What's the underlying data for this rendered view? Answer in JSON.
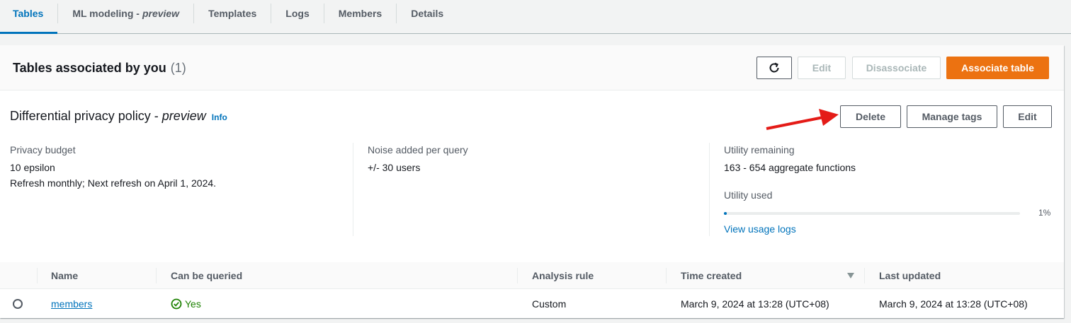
{
  "tabs": [
    {
      "label": "Tables",
      "active": true
    },
    {
      "label": "ML modeling -",
      "suffix": "preview"
    },
    {
      "label": "Templates"
    },
    {
      "label": "Logs"
    },
    {
      "label": "Members"
    },
    {
      "label": "Details"
    }
  ],
  "panel": {
    "title": "Tables associated by you",
    "count": "(1)",
    "refresh_icon": "refresh-icon",
    "edit_label": "Edit",
    "disassociate_label": "Disassociate",
    "associate_label": "Associate table"
  },
  "policy": {
    "title": "Differential privacy policy -",
    "title_suffix": "preview",
    "info_label": "Info",
    "delete_label": "Delete",
    "manage_tags_label": "Manage tags",
    "edit_label": "Edit",
    "privacy_budget_label": "Privacy budget",
    "privacy_budget_value": "10 epsilon",
    "privacy_budget_refresh": "Refresh monthly; Next refresh on April 1, 2024.",
    "noise_label": "Noise added per query",
    "noise_value": "+/- 30 users",
    "utility_remaining_label": "Utility remaining",
    "utility_remaining_value": "163 - 654 aggregate functions",
    "utility_used_label": "Utility used",
    "utility_used_fraction": 0.01,
    "utility_used_pct": "1%",
    "view_logs_label": "View usage logs"
  },
  "table": {
    "headers": [
      "Name",
      "Can be queried",
      "Analysis rule",
      "Time created",
      "Last updated"
    ],
    "sort_icon": "sort-descending-icon",
    "rows": [
      {
        "name": "members",
        "can_be_queried": "Yes",
        "analysis_rule": "Custom",
        "time_created": "March 9, 2024 at 13:28 (UTC+08)",
        "last_updated": "March 9, 2024 at 13:28 (UTC+08)"
      }
    ]
  },
  "colors": {
    "accent": "#0073bb",
    "primary_button": "#ec7211",
    "success": "#1d8102",
    "annotation_arrow": "#e41b17"
  }
}
